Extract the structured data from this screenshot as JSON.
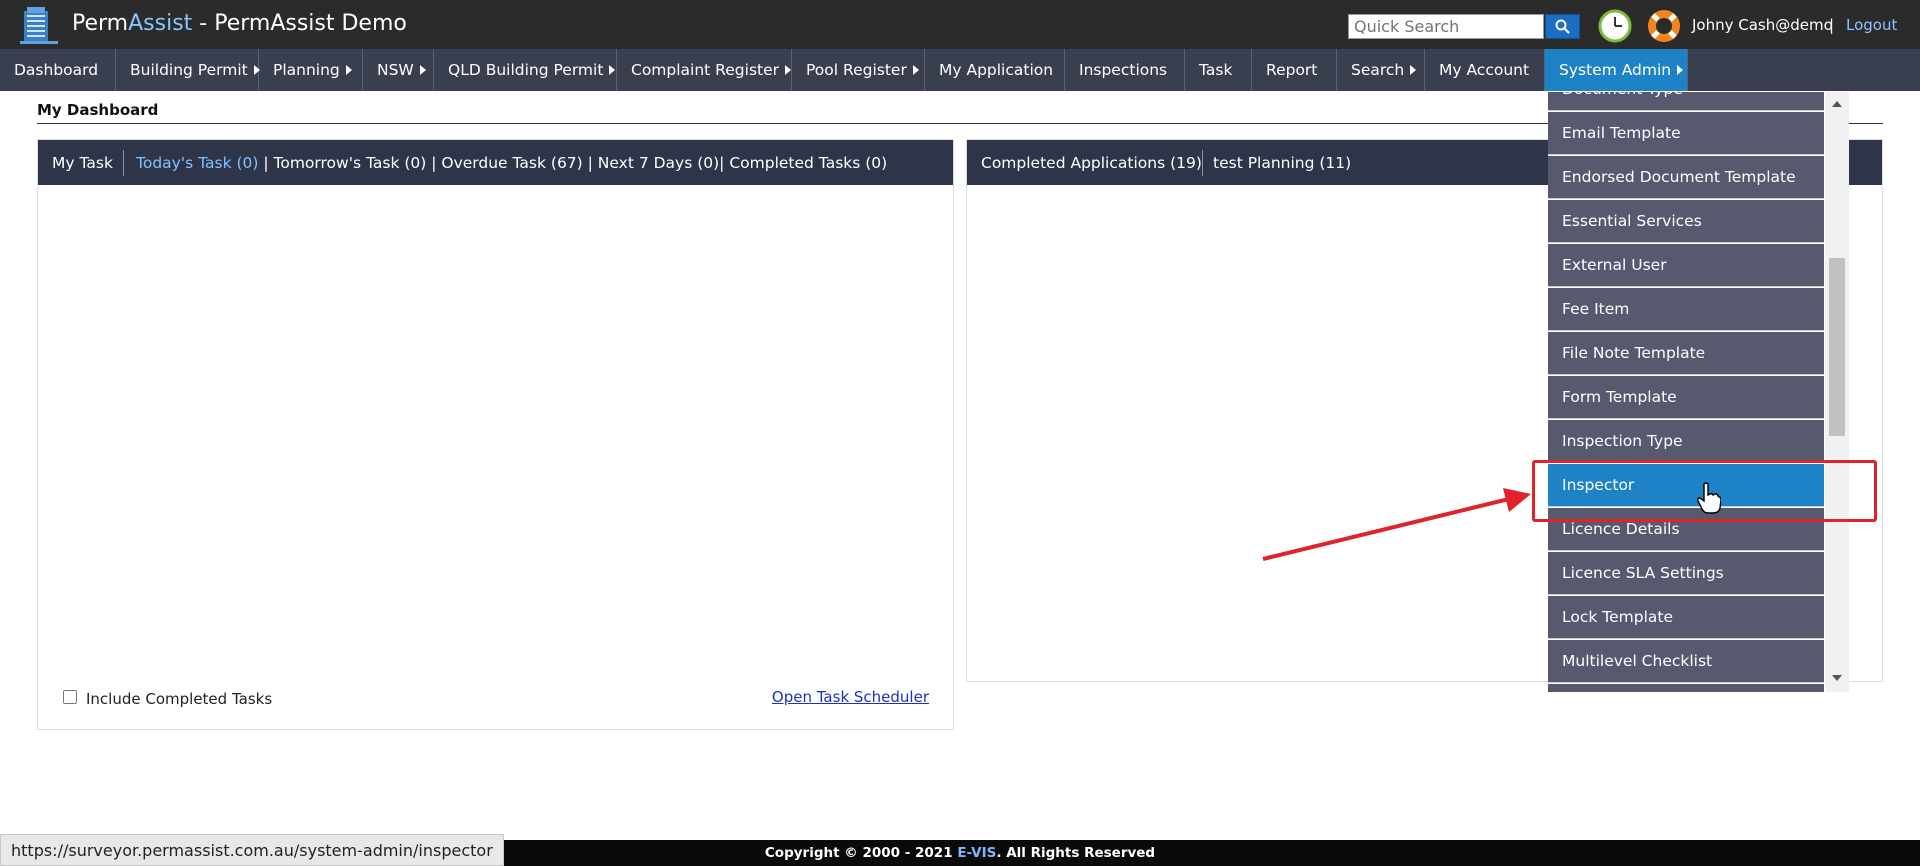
{
  "app": {
    "brand_perm": "Perm",
    "brand_assist": "Assist",
    "brand_suffix": " - PermAssist Demo"
  },
  "header": {
    "search_placeholder": "Quick Search",
    "user_name": "Johny Cash@demo",
    "separator": "|",
    "logout_label": "Logout"
  },
  "nav": {
    "items": [
      {
        "label": "Dashboard"
      },
      {
        "label": "Building Permit"
      },
      {
        "label": "Planning"
      },
      {
        "label": "NSW"
      },
      {
        "label": "QLD Building Permit"
      },
      {
        "label": "Complaint Register"
      },
      {
        "label": "Pool Register"
      },
      {
        "label": "My Application"
      },
      {
        "label": "Inspections"
      },
      {
        "label": "Task"
      },
      {
        "label": "Report"
      },
      {
        "label": "Search"
      },
      {
        "label": "My Account"
      },
      {
        "label": "System Admin"
      }
    ]
  },
  "dashboard": {
    "title": "My Dashboard",
    "left_panel": {
      "tab_my_task": "My Task",
      "tab_today": "Today's Task (0)",
      "tab_rest": " | Tomorrow's Task (0) | Overdue Task (67) | Next 7 Days (0)| Completed Tasks (0)",
      "include_completed_label": "Include Completed Tasks",
      "open_scheduler_label": "Open Task Scheduler"
    },
    "right_panel": {
      "tab_completed": "Completed Applications (19)",
      "tab_planning": "test Planning (11)"
    }
  },
  "dropdown": {
    "items": [
      {
        "label": "Document Type"
      },
      {
        "label": "Email Template"
      },
      {
        "label": "Endorsed Document Template"
      },
      {
        "label": "Essential Services"
      },
      {
        "label": "External User"
      },
      {
        "label": "Fee Item"
      },
      {
        "label": "File Note Template"
      },
      {
        "label": "Form Template"
      },
      {
        "label": "Inspection Type"
      },
      {
        "label": "Inspector"
      },
      {
        "label": "Licence Details"
      },
      {
        "label": "Licence SLA Settings"
      },
      {
        "label": "Lock Template"
      },
      {
        "label": "Multilevel Checklist"
      },
      {
        "label": ""
      }
    ],
    "selected_label": "Inspector"
  },
  "footer": {
    "copyright_prefix": "Copyright © 2000 - 2021 ",
    "company": "E-VIS",
    "copyright_suffix": ". All Rights Reserved"
  },
  "status_bar": {
    "url": "https://surveyor.permassist.com.au/system-admin/inspector"
  },
  "colors": {
    "header_bg": "#2b2b2b",
    "nav_bg": "#3a3f50",
    "active_accent": "#1e82c6",
    "panel_head_bg": "#2e3549",
    "dropdown_item_bg": "#575a6e",
    "annotation_red": "#e0232a"
  }
}
